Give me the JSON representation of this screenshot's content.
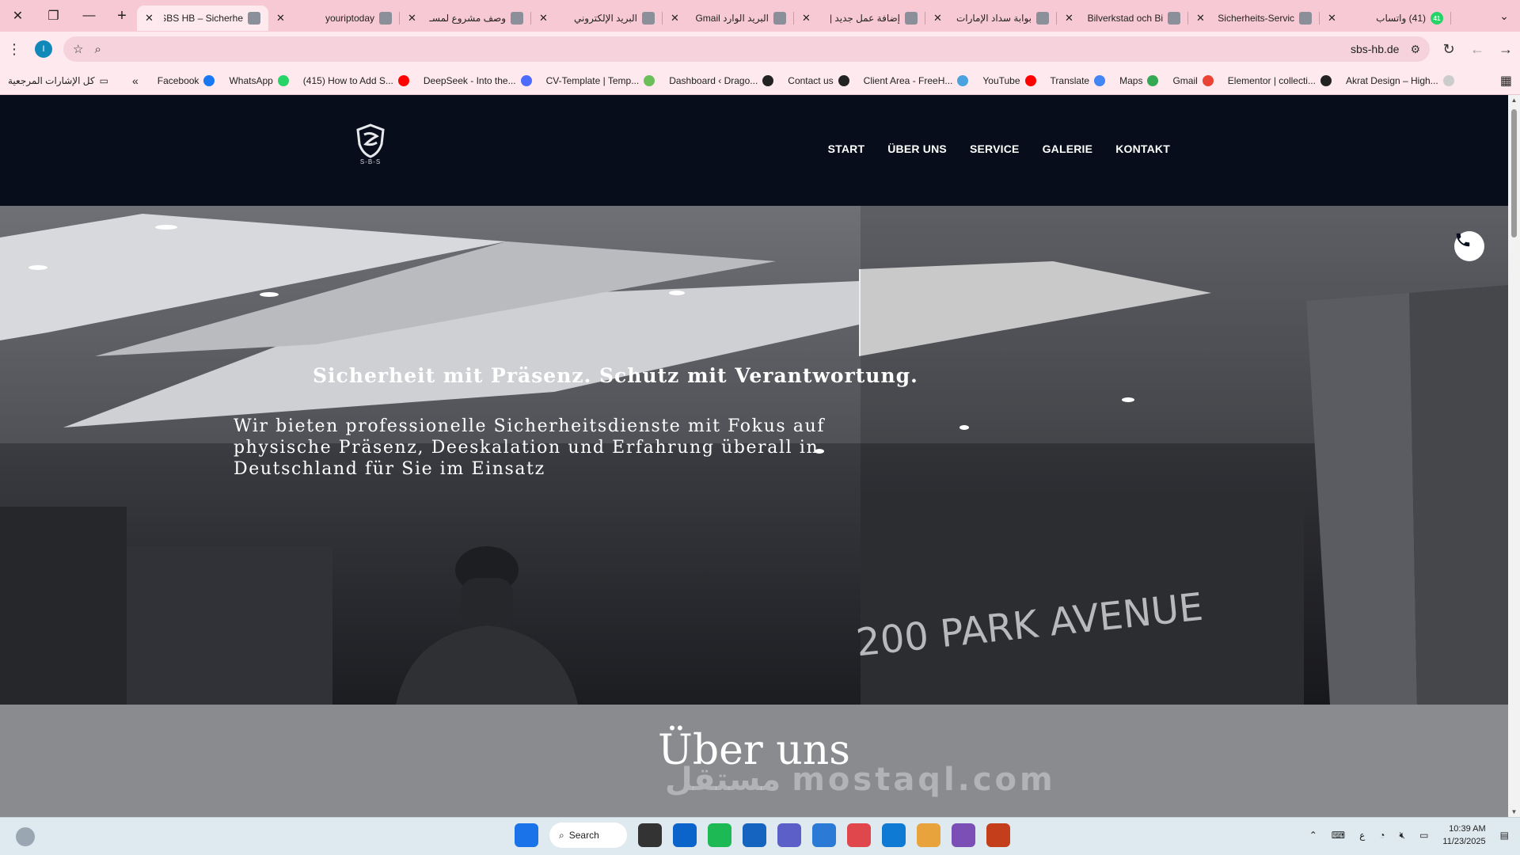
{
  "browser": {
    "window_controls": {
      "close": "✕",
      "restore": "❐",
      "minimize": "—",
      "new_tab": "+"
    },
    "tabs": [
      {
        "title": "SBS HB – Sicherhe",
        "icon": "sbs-shield-icon",
        "active": true
      },
      {
        "title": "youriptoday",
        "icon": "website-icon",
        "active": false
      },
      {
        "title": "وصف مشروع لمسـ",
        "icon": "openai-icon",
        "active": false
      },
      {
        "title": "البريد الإلكتروني",
        "icon": "google-icon",
        "active": false
      },
      {
        "title": "البريد الوارد Gmail",
        "icon": "gmail-icon",
        "active": false
      },
      {
        "title": "إضافة عمل جديد |",
        "icon": "mostaql-icon",
        "active": false
      },
      {
        "title": "بوابة سداد الإمارات",
        "icon": "uae-pay-icon",
        "active": false
      },
      {
        "title": "Bilverkstad och Bi",
        "icon": "shield-icon",
        "active": false
      },
      {
        "title": "Sicherheits-Servic",
        "icon": "website-icon",
        "active": false
      },
      {
        "title": "(41) واتساب",
        "icon": "whatsapp-icon",
        "badge": "41",
        "active": false
      }
    ],
    "profile_initial": "I",
    "url": "sbs-hb.de",
    "bookmarks": [
      {
        "label": "Facebook",
        "icon": "facebook-icon",
        "color": "#1877f2"
      },
      {
        "label": "WhatsApp",
        "icon": "whatsapp-icon",
        "color": "#25d366"
      },
      {
        "label": "(415) How to Add S...",
        "icon": "youtube-icon",
        "color": "#ff0000"
      },
      {
        "label": "DeepSeek - Into the...",
        "icon": "deepseek-icon",
        "color": "#4d6bfe"
      },
      {
        "label": "CV-Template | Temp...",
        "icon": "cv-icon",
        "color": "#6bbf59"
      },
      {
        "label": "Dashboard ‹ Drago...",
        "icon": "wordpress-icon",
        "color": "#222222"
      },
      {
        "label": "Contact us",
        "icon": "globe-icon",
        "color": "#222222"
      },
      {
        "label": "Client Area - FreeH...",
        "icon": "freehost-icon",
        "color": "#4aa3df"
      },
      {
        "label": "YouTube",
        "icon": "youtube-icon",
        "color": "#ff0000"
      },
      {
        "label": "Translate",
        "icon": "translate-icon",
        "color": "#4285f4"
      },
      {
        "label": "Maps",
        "icon": "maps-icon",
        "color": "#34a853"
      },
      {
        "label": "Gmail",
        "icon": "gmail-icon",
        "color": "#ea4335"
      },
      {
        "label": "Elementor | collecti...",
        "icon": "globe-icon",
        "color": "#222222"
      },
      {
        "label": "Akrat Design – High...",
        "icon": "akrat-icon",
        "color": "#cccccc"
      }
    ],
    "bookmarks_all": "كل الإشارات المرجعية"
  },
  "site": {
    "logo_text": "S-B-S",
    "nav": [
      "START",
      "ÜBER UNS",
      "SERVICE",
      "GALERIE",
      "KONTAKT"
    ],
    "hero": {
      "title": "Sicherheit mit Präsenz. Schutz mit Verantwortung.",
      "subtitle": "Wir bieten professionelle Sicherheitsdienste mit Fokus auf physische Präsenz, Deeskalation und Erfahrung überall in Deutschland für Sie im Einsatz",
      "sign_text": "200 PARK AVENUE"
    },
    "about_title": "Über uns",
    "watermark": "مستقل mostaql.com"
  },
  "taskbar": {
    "search_label": "Search",
    "pinned": [
      {
        "name": "windows-start-icon",
        "color": "#1a73e8"
      },
      {
        "name": "file-explorer-icon",
        "color": "#333333"
      },
      {
        "name": "outlook-icon",
        "color": "#0a64c9"
      },
      {
        "name": "spotify-icon",
        "color": "#1db954"
      },
      {
        "name": "defender-icon",
        "color": "#1565c0"
      },
      {
        "name": "teams-icon",
        "color": "#5b5fc7"
      },
      {
        "name": "calculator-icon",
        "color": "#2b7bd6"
      },
      {
        "name": "chrome-icon",
        "color": "#e0474c"
      },
      {
        "name": "vscode-icon",
        "color": "#0e7ad4"
      },
      {
        "name": "office-icon",
        "color": "#e8a33c"
      },
      {
        "name": "visual-studio-icon",
        "color": "#7b4fb5"
      },
      {
        "name": "powerpoint-icon",
        "color": "#c43e1c"
      }
    ],
    "keyboard_lang": "ع",
    "time": "10:39 AM",
    "date": "11/23/2025"
  }
}
